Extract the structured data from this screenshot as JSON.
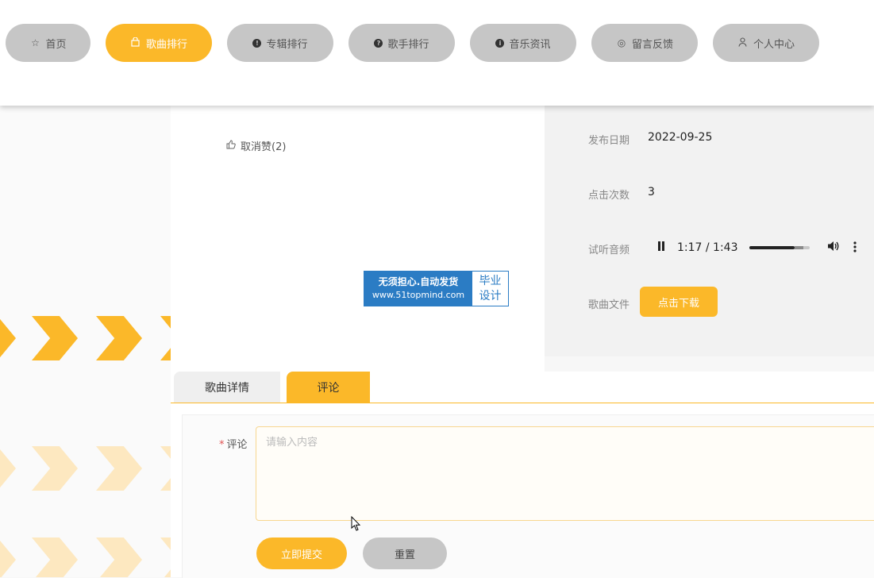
{
  "nav": {
    "items": [
      {
        "label": "首页",
        "icon": "star-icon",
        "active": false
      },
      {
        "label": "歌曲排行",
        "icon": "bag-icon",
        "active": true
      },
      {
        "label": "专辑排行",
        "icon": "exclamation-circle-icon",
        "active": false
      },
      {
        "label": "歌手排行",
        "icon": "question-circle-icon",
        "active": false
      },
      {
        "label": "音乐资讯",
        "icon": "info-circle-icon",
        "active": false
      },
      {
        "label": "留言反馈",
        "icon": "at-circle-icon",
        "active": false
      },
      {
        "label": "个人中心",
        "icon": "user-icon",
        "active": false
      }
    ]
  },
  "song": {
    "unlike_label": "取消赞(2)"
  },
  "watermark": {
    "main": "无须担心.自动发货",
    "url": "www.51topmind.com",
    "side_top": "毕业",
    "side_bottom": "设计"
  },
  "info": {
    "publish_date_label": "发布日期",
    "publish_date": "2022-09-25",
    "clicks_label": "点击次数",
    "clicks": "3",
    "audio_label": "试听音频",
    "file_label": "歌曲文件",
    "download_label": "点击下载"
  },
  "audio": {
    "time": "1:17 / 1:43",
    "progress": 0.75
  },
  "tabs": {
    "detail": "歌曲详情",
    "comment": "评论"
  },
  "comment_form": {
    "label": "评论",
    "required_mark": "*",
    "placeholder": "请输入内容",
    "submit": "立即提交",
    "reset": "重置"
  },
  "colors": {
    "accent": "#fbb829",
    "nav_inactive": "#c6c6c6",
    "watermark_blue": "#2b7cc4"
  }
}
